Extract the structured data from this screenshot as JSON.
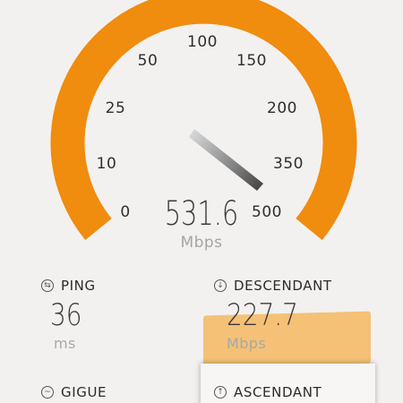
{
  "gauge": {
    "ticks": [
      "0",
      "10",
      "25",
      "50",
      "100",
      "150",
      "200",
      "350",
      "500"
    ],
    "speed_value": "531.6",
    "speed_unit": "Mbps",
    "accent_color": "#f08c0e"
  },
  "metrics": {
    "ping": {
      "label": "PING",
      "value": "36",
      "unit": "ms",
      "icon": "ping-icon"
    },
    "download": {
      "label": "DESCENDANT",
      "value": "227.7",
      "unit": "Mbps",
      "icon": "download-arrow-icon"
    },
    "jitter": {
      "label": "GIGUE",
      "icon": "jitter-icon"
    },
    "upload": {
      "label": "ASCENDANT",
      "icon": "upload-arrow-icon"
    }
  },
  "highlight_color": "#f4b860"
}
